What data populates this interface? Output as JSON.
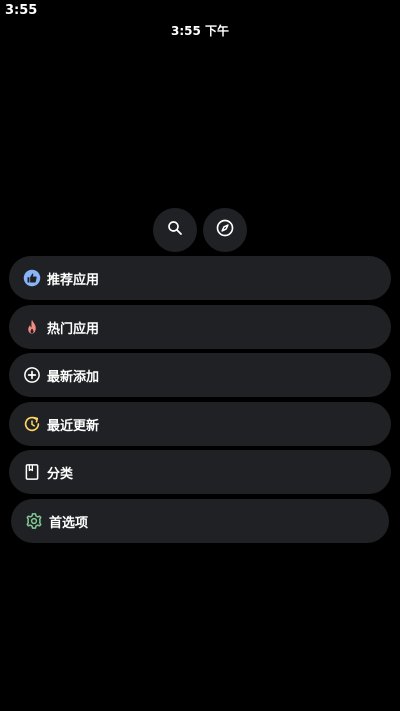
{
  "status_bar": {
    "time": "3:55"
  },
  "clock": {
    "text": "3:55 下午"
  },
  "actions": {
    "search_icon": "search-icon",
    "explore_icon": "compass-icon"
  },
  "menu": {
    "items": [
      {
        "label": "推荐应用",
        "icon": "thumbs-up-icon",
        "color": "#8ab4f8"
      },
      {
        "label": "热门应用",
        "icon": "flame-icon",
        "color": "#f28b82"
      },
      {
        "label": "最新添加",
        "icon": "add-circle-icon",
        "color": "#ffffff"
      },
      {
        "label": "最近更新",
        "icon": "update-icon",
        "color": "#fdd663"
      },
      {
        "label": "分类",
        "icon": "category-icon",
        "color": "#ffffff"
      },
      {
        "label": "首选项",
        "icon": "gear-icon",
        "color": "#81c995"
      }
    ]
  }
}
